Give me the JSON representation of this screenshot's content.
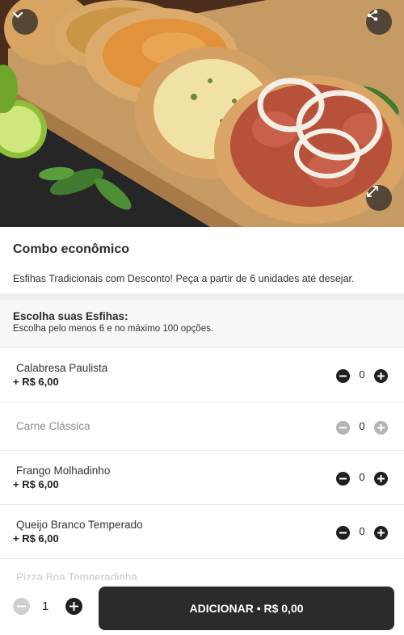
{
  "hero": {
    "back_icon": "chevron-down-icon",
    "share_icon": "share-icon",
    "expand_icon": "expand-icon",
    "image_subject": "esfihas on wooden board"
  },
  "product": {
    "title": "Combo econômico",
    "description": "Esfihas Tradicionais com Desconto! Peça a partir de 6 unidades até desejar."
  },
  "section": {
    "title": "Escolha suas Esfihas:",
    "subtitle": "Escolha pelo menos 6 e no máximo 100 opções."
  },
  "options": [
    {
      "name": "Calabresa Paulista",
      "price": "+ R$ 6,00",
      "qty": "0",
      "disabled": false
    },
    {
      "name": "Carne Clássica",
      "price": "",
      "qty": "0",
      "disabled": true
    },
    {
      "name": "Frango Molhadinho",
      "price": "+ R$ 6,00",
      "qty": "0",
      "disabled": false
    },
    {
      "name": "Queijo Branco Temperado",
      "price": "+ R$ 6,00",
      "qty": "0",
      "disabled": false
    }
  ],
  "partial_item": "Pizza Boa Temperadinha",
  "footer": {
    "quantity": "1",
    "add_label": "ADICIONAR • R$ 0,00"
  },
  "colors": {
    "primary_button": "#2b2b2b",
    "disabled_control": "#b5b5b5",
    "divider": "#efefef"
  }
}
